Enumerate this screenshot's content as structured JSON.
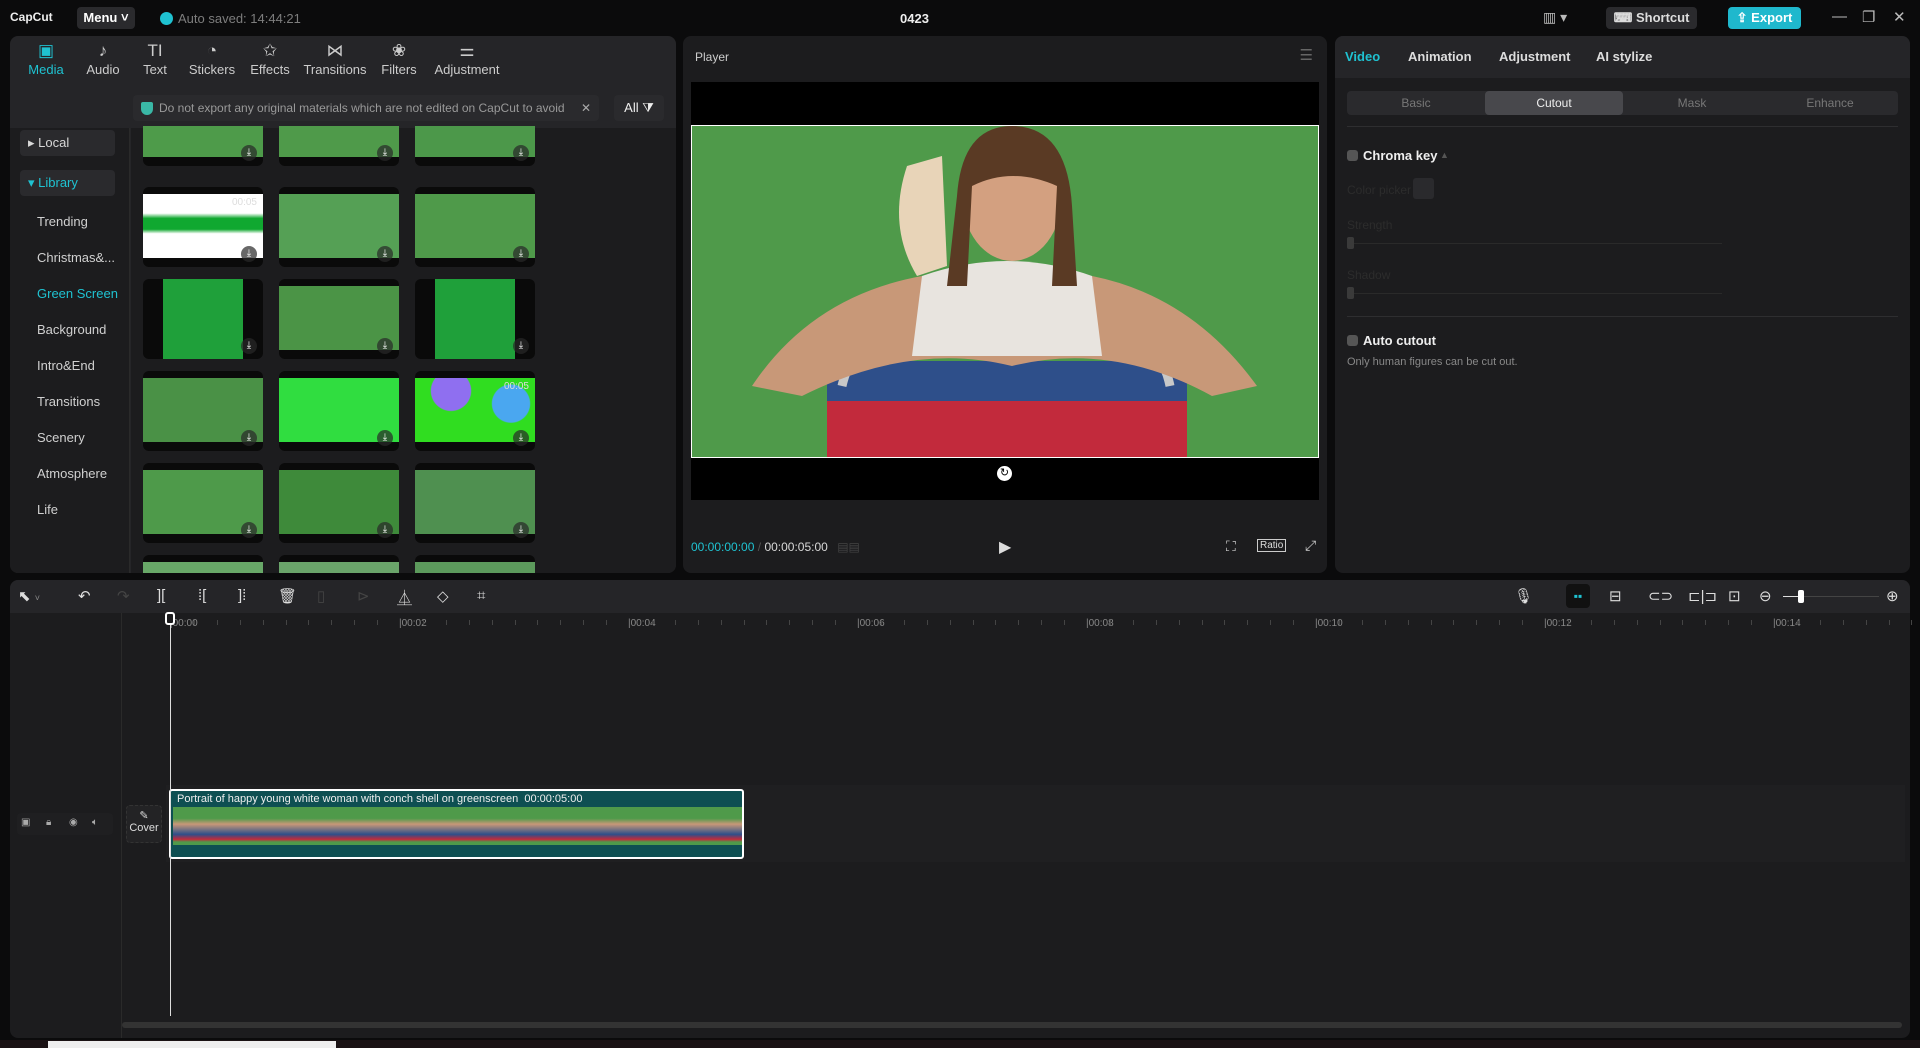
{
  "titlebar": {
    "logo": "CapCut",
    "menu": "Menu",
    "autosave": "Auto saved: 14:44:21",
    "project": "0423",
    "shortcut": "Shortcut",
    "export": "Export"
  },
  "toolbar_tabs": [
    {
      "label": "Media",
      "icon": "media-icon",
      "active": true
    },
    {
      "label": "Audio",
      "icon": "audio-icon"
    },
    {
      "label": "Text",
      "icon": "text-icon"
    },
    {
      "label": "Stickers",
      "icon": "sticker-icon"
    },
    {
      "label": "Effects",
      "icon": "effects-icon"
    },
    {
      "label": "Transitions",
      "icon": "transitions-icon"
    },
    {
      "label": "Filters",
      "icon": "filters-icon"
    },
    {
      "label": "Adjustment",
      "icon": "adjustment-icon"
    }
  ],
  "sidebar": {
    "local": "Local",
    "library": "Library",
    "items": [
      "Trending",
      "Christmas&...",
      "Green Screen",
      "Background",
      "Intro&End",
      "Transitions",
      "Scenery",
      "Atmosphere",
      "Life"
    ],
    "active": "Green Screen"
  },
  "notice": {
    "text": "Do not export any original materials which are not edited on CapCut to avoid",
    "filter": "All"
  },
  "media_thumbs": [
    {
      "duration": "00:05"
    },
    {
      "duration": "00:05"
    }
  ],
  "player": {
    "title": "Player",
    "current": "00:00:00:00",
    "total": "00:00:05:00",
    "ratio": "Ratio"
  },
  "right_panel": {
    "tabs": [
      "Video",
      "Animation",
      "Adjustment",
      "AI stylize"
    ],
    "active_tab": "Video",
    "subtabs": [
      "Basic",
      "Cutout",
      "Mask",
      "Enhance"
    ],
    "active_subtab": "Cutout",
    "chroma_key": "Chroma key",
    "color_picker": "Color picker",
    "strength": "Strength",
    "shadow": "Shadow",
    "auto_cutout": "Auto cutout",
    "auto_cutout_hint": "Only human figures can be cut out."
  },
  "timeline": {
    "ruler": [
      "00:00",
      "00:02",
      "00:04",
      "00:06",
      "00:08",
      "00:10",
      "00:12",
      "00:14"
    ],
    "cover": "Cover",
    "clip": {
      "title": "Portrait of happy young white woman with conch shell on greenscreen",
      "duration": "00:00:05:00"
    },
    "zoom_level": 0.05
  },
  "colors": {
    "accent": "#1fc2d1",
    "clip": "#0e4f52",
    "green_screen": "#4f9a4a"
  }
}
